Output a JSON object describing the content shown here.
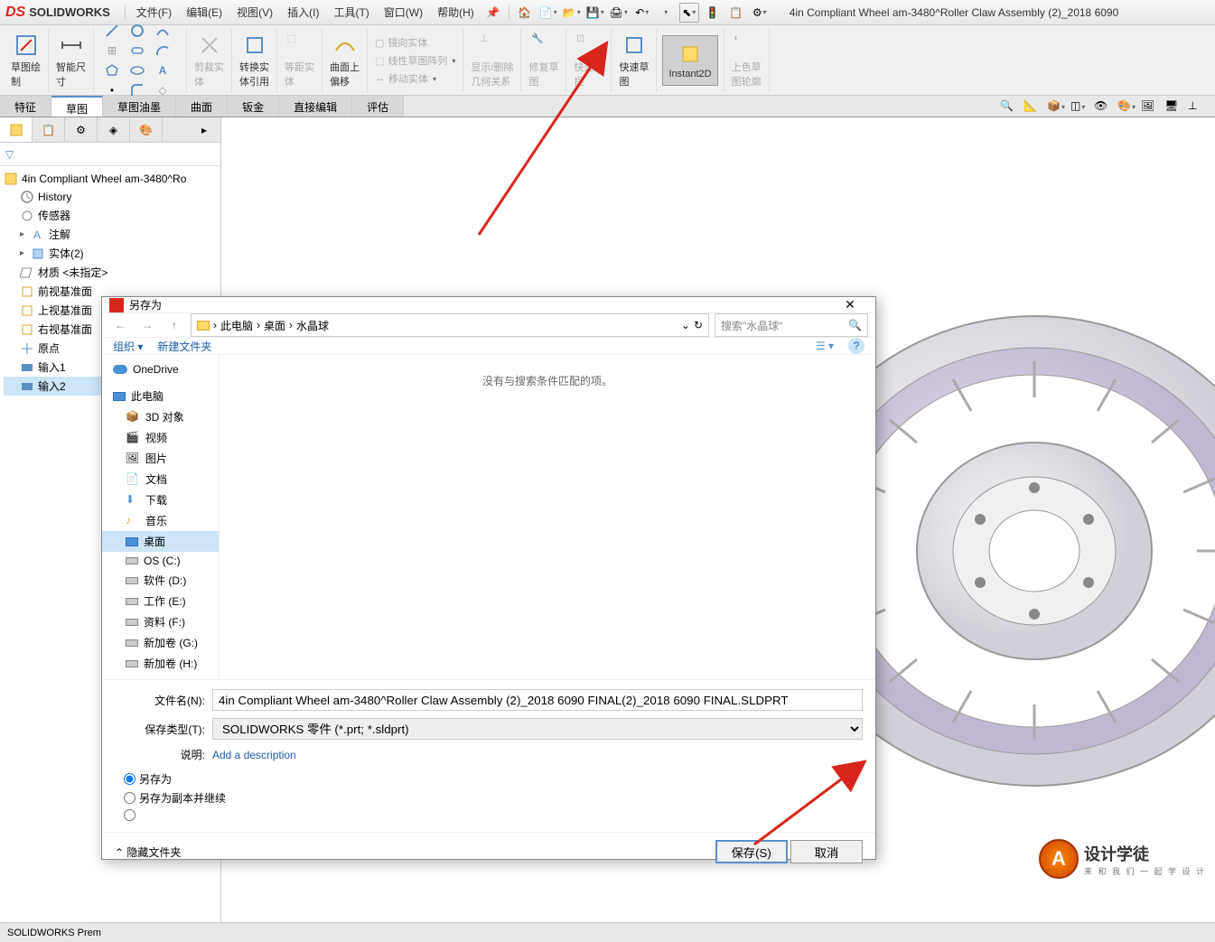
{
  "app": {
    "logo": "DS",
    "name": "SOLIDWORKS",
    "docTitle": "4in Compliant Wheel am-3480^Roller Claw Assembly (2)_2018 6090"
  },
  "menu": [
    "文件(F)",
    "编辑(E)",
    "视图(V)",
    "插入(I)",
    "工具(T)",
    "窗口(W)",
    "帮助(H)"
  ],
  "ribbon": {
    "sketchDraw": "草图绘\n制",
    "smartDim": "智能尺\n寸",
    "trim": "剪裁实\n体",
    "convert": "转换实\n体引用",
    "equalDist": "等距实\n体",
    "surface": "曲面上\n偏移",
    "mirror": "镜向实体",
    "linear": "线性草图阵列",
    "move": "移动实体",
    "showDel": "显示/删除\n几何关系",
    "repair": "修复草\n图",
    "quickSnap": "快速捕\n捉",
    "rapidSketch": "快速草\n图",
    "instant2d": "Instant2D",
    "colorSketch": "上色草\n图轮廓"
  },
  "tabs": [
    "特征",
    "草图",
    "草图油墨",
    "曲面",
    "钣金",
    "直接编辑",
    "评估"
  ],
  "activeTab": "草图",
  "tree": {
    "root": "4in Compliant Wheel am-3480^Ro",
    "items": [
      {
        "label": "History",
        "indent": 1
      },
      {
        "label": "传感器",
        "indent": 1
      },
      {
        "label": "注解",
        "indent": 1,
        "expand": true
      },
      {
        "label": "实体(2)",
        "indent": 1,
        "expand": true
      },
      {
        "label": "材质 <未指定>",
        "indent": 1
      },
      {
        "label": "前视基准面",
        "indent": 1
      },
      {
        "label": "上视基准面",
        "indent": 1
      },
      {
        "label": "右视基准面",
        "indent": 1
      },
      {
        "label": "原点",
        "indent": 1
      },
      {
        "label": "输入1",
        "indent": 1
      },
      {
        "label": "输入2",
        "indent": 1,
        "selected": true
      }
    ]
  },
  "dialog": {
    "title": "另存为",
    "breadcrumb": [
      "此电脑",
      "桌面",
      "水晶球"
    ],
    "searchPlaceholder": "搜索\"水晶球\"",
    "organize": "组织",
    "newFolder": "新建文件夹",
    "emptyMsg": "没有与搜索条件匹配的项。",
    "sidebar": [
      {
        "label": "OneDrive",
        "icon": "cloud"
      },
      {
        "label": "此电脑",
        "icon": "pc"
      },
      {
        "label": "3D 对象",
        "icon": "folder",
        "indent": true
      },
      {
        "label": "视频",
        "icon": "folder",
        "indent": true
      },
      {
        "label": "图片",
        "icon": "folder",
        "indent": true
      },
      {
        "label": "文档",
        "icon": "folder",
        "indent": true
      },
      {
        "label": "下载",
        "icon": "folder",
        "indent": true
      },
      {
        "label": "音乐",
        "icon": "folder",
        "indent": true
      },
      {
        "label": "桌面",
        "icon": "folder",
        "indent": true,
        "selected": true
      },
      {
        "label": "OS (C:)",
        "icon": "drive",
        "indent": true
      },
      {
        "label": "软件 (D:)",
        "icon": "drive",
        "indent": true
      },
      {
        "label": "工作 (E:)",
        "icon": "drive",
        "indent": true
      },
      {
        "label": "资料 (F:)",
        "icon": "drive",
        "indent": true
      },
      {
        "label": "新加卷 (G:)",
        "icon": "drive",
        "indent": true
      },
      {
        "label": "新加卷 (H:)",
        "icon": "drive",
        "indent": true
      }
    ],
    "fileNameLabel": "文件名(N):",
    "fileName": "4in Compliant Wheel am-3480^Roller Claw Assembly (2)_2018 6090 FINAL(2)_2018 6090 FINAL.SLDPRT",
    "saveTypeLabel": "保存类型(T):",
    "saveType": "SOLIDWORKS 零件 (*.prt; *.sldprt)",
    "descLabel": "说明:",
    "descPlaceholder": "Add a description",
    "radio1": "另存为",
    "radio2": "另存为副本并继续",
    "hideFolder": "隐藏文件夹",
    "saveBtn": "保存(S)",
    "cancelBtn": "取消"
  },
  "watermark": {
    "main": "设计学徒",
    "sub": "来 和 我 们 一 起 学 设 计"
  },
  "statusbar": "SOLIDWORKS Prem"
}
